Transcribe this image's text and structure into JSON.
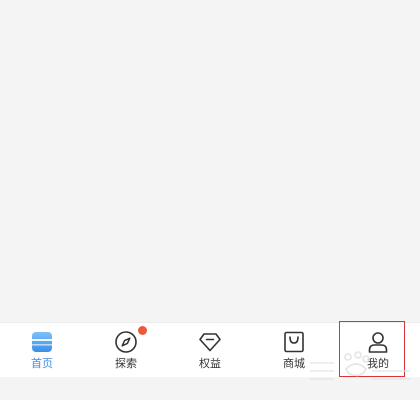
{
  "tabbar": {
    "items": [
      {
        "label": "首页",
        "icon": "home-icon",
        "active": true
      },
      {
        "label": "探索",
        "icon": "compass-icon",
        "badge": true
      },
      {
        "label": "权益",
        "icon": "diamond-icon"
      },
      {
        "label": "商城",
        "icon": "shopping-bag-icon"
      },
      {
        "label": "我的",
        "icon": "user-icon"
      }
    ]
  },
  "colors": {
    "active": "#3d8fe6",
    "inactive": "#333333",
    "badge": "#e85a3c",
    "highlight": "#d8343a",
    "background": "#f4f4f4"
  }
}
